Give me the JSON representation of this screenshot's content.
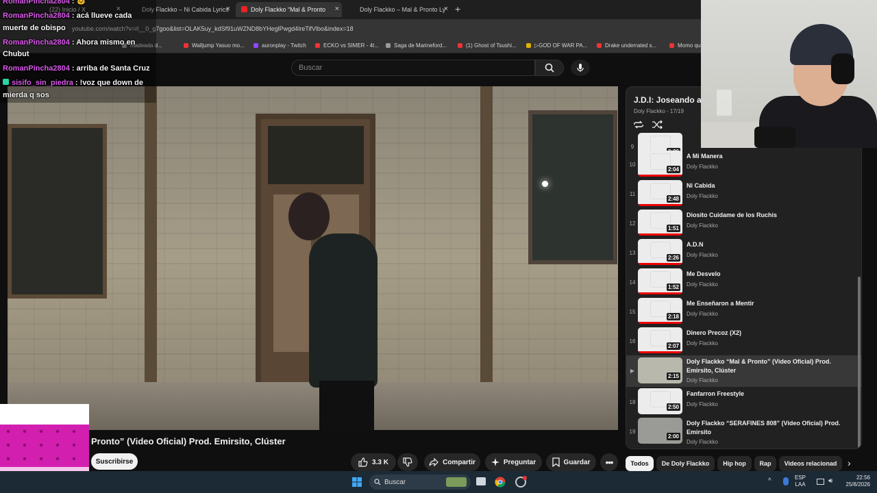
{
  "browser": {
    "tabs": [
      {
        "label": "(22) Inicio / X"
      },
      {
        "label": "Doly Flackko – Ni Cabida Lyrics"
      },
      {
        "label": "Doly Flackko “Mal & Pronto"
      },
      {
        "label": "Doly Flackko – Mal & Pronto Ly"
      }
    ],
    "url": "youtube.com/watch?v=rl__0_g7goo&list=OLAK5uy_kdSf91uWZND8bYHeglPwgd4lreTifVlbo&index=18",
    "bookmarks": [
      "madeada d...",
      "Walljump Yasuo mo...",
      "auronplay - Twitch",
      "ECKO vs SIMER - 4t...",
      "Saga de Marineford...",
      "(1) Ghost of Tsushi...",
      "▷GOD OF WAR PA...",
      "Drake underrated s...",
      "Momo quie"
    ]
  },
  "youtube": {
    "search_placeholder": "Buscar",
    "video_title": "Pronto” (Video Oficial) Prod. Emirsito, Clúster",
    "subscribe_label": "Suscribirse",
    "like_count": "3.3 K",
    "share_label": "Compartir",
    "ask_label": "Preguntar",
    "save_label": "Guardar"
  },
  "playlist": {
    "title": "J.D.I: Joseando a",
    "subtitle": "Doly Flackko - 17/19",
    "items": [
      {
        "index": "9",
        "title": "",
        "artist": "Doly Flackko",
        "duration": "2:26"
      },
      {
        "index": "10",
        "title": "A Mi Manera",
        "artist": "Doly Flackko",
        "duration": "2:04"
      },
      {
        "index": "11",
        "title": "Ni Cabida",
        "artist": "Doly Flackko",
        "duration": "2:48"
      },
      {
        "index": "12",
        "title": "Diosito Cuidame de los Ruchis",
        "artist": "Doly Flackko",
        "duration": "1:51"
      },
      {
        "index": "13",
        "title": "A.D.N",
        "artist": "Doly Flackko",
        "duration": "2:26"
      },
      {
        "index": "14",
        "title": "Me Desvelo",
        "artist": "Doly Flackko",
        "duration": "1:52"
      },
      {
        "index": "15",
        "title": "Me Enseñaron a Mentir",
        "artist": "Doly Flackko",
        "duration": "2:18"
      },
      {
        "index": "16",
        "title": "Dinero Precoz (X2)",
        "artist": "Doly Flackko",
        "duration": "2:07"
      },
      {
        "index": "▶",
        "title": "Doly Flackko “Mal & Pronto” (Video Oficial) Prod. Emirsito, Clúster",
        "artist": "Doly Flackko",
        "duration": "2:15"
      },
      {
        "index": "18",
        "title": "Fanfarron Freestyle",
        "artist": "Doly Flackko",
        "duration": "2:50"
      },
      {
        "index": "19",
        "title": "Doly Flackko “SERAFINES 808” (Video Oficial) Prod. Emirsito",
        "artist": "Doly Flackko",
        "duration": "2:00"
      }
    ]
  },
  "chips": [
    "Todos",
    "De Doly Flackko",
    "Hip hop",
    "Rap",
    "Videos relacionad"
  ],
  "chat": [
    {
      "user": "RomanPincha2804",
      "message": ""
    },
    {
      "user": "",
      "message": "acá llueve cada"
    },
    {
      "user": "",
      "message": "muerte de obispo"
    },
    {
      "user": "RomanPincha2804",
      "message": "Ahora mismo en"
    },
    {
      "user": "",
      "message": "Chubut"
    },
    {
      "user": "RomanPincha2804",
      "message": "arriba de Santa Cruz"
    },
    {
      "user": "sisifo_sin_piedra",
      "message": "!voz que down de"
    },
    {
      "user": "",
      "message": "mierda q sos"
    }
  ],
  "taskbar": {
    "search_label": "Buscar",
    "lang_top": "ESP",
    "lang_bottom": "LAA",
    "time": "22:56",
    "date": "25/8/2026"
  },
  "colors": {
    "chat_user": "#d957ea",
    "progress_red": "#ff0000",
    "taskbar": "#1c2a36"
  }
}
